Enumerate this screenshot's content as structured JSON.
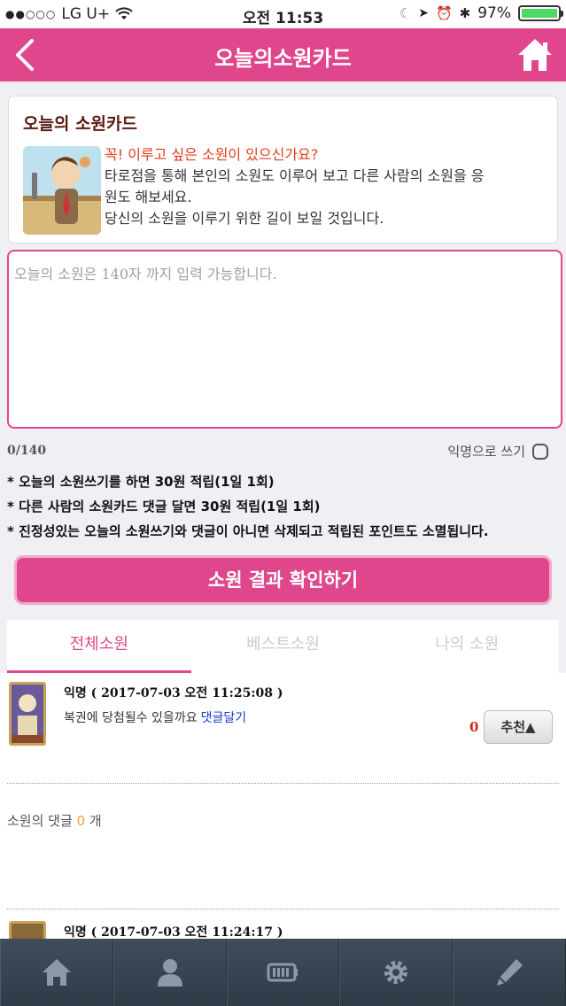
{
  "status": {
    "carrier": "LG U+",
    "time": "오전 11:53",
    "battery": "97%"
  },
  "header": {
    "title": "오늘의소원카드"
  },
  "intro": {
    "title": "오늘의 소원카드",
    "highlight": "꼭! 이루고 싶은 소원이 있으신가요?",
    "line1": "타로점을 통해 본인의 소원도 이루어 보고 다른 사람의 소원을 응",
    "line2": "원도 해보세요.",
    "line3": "당신의 소원을 이루기 위한 길이 보일 것입니다."
  },
  "wish": {
    "placeholder": "오늘의 소원은 140자 까지 입력 가능합니다.",
    "counter": "0/140",
    "anonymous_label": "익명으로 쓰기"
  },
  "notes": [
    "* 오늘의 소원쓰기를 하면 30원 적립(1일 1회)",
    "* 다른 사람의 소원카드 댓글 달면 30원 적립(1일 1회)",
    "* 진정성있는 오늘의 소원쓰기와 댓글이 아니면 삭제되고 적립된 포인트도 소멸됩니다."
  ],
  "cta_label": "소원 결과 확인하기",
  "tabs": [
    "전체소원",
    "베스트소원",
    "나의 소원"
  ],
  "posts": [
    {
      "author_date": "익명 ( 2017-07-03 오전 11:25:08 )",
      "message": "복권에 당첨될수 있을까요",
      "comment_link": "댓글달기",
      "votes": "0",
      "recommend_label": "추천▲",
      "comment_prefix": "소원의 댓글",
      "comment_count": "0",
      "comment_suffix": "개"
    },
    {
      "author_date": "익명 ( 2017-07-03 오전 11:24:17 )"
    }
  ],
  "colors": {
    "brand_pink": "#e0468b",
    "alert_red": "#e53b1a",
    "link_blue": "#1a3acb"
  },
  "bottom_nav": [
    "home-icon",
    "person-icon",
    "battery-icon",
    "gear-icon",
    "pencil-icon"
  ]
}
